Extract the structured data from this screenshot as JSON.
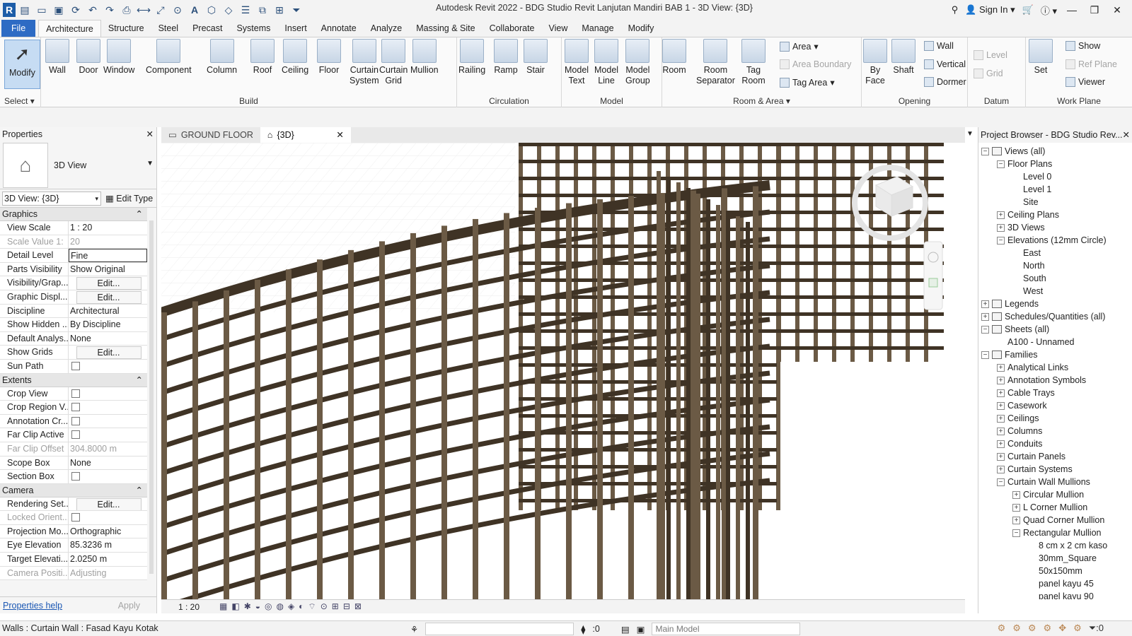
{
  "titlebar": {
    "title": "Autodesk Revit 2022 - BDG Studio Revit Lanjutan Mandiri BAB 1 - 3D View: {3D}",
    "sign_in": "Sign In",
    "logo": "R"
  },
  "tabs": [
    "File",
    "Architecture",
    "Structure",
    "Steel",
    "Precast",
    "Systems",
    "Insert",
    "Annotate",
    "Analyze",
    "Massing & Site",
    "Collaborate",
    "View",
    "Manage",
    "Modify"
  ],
  "ribbon": {
    "select": {
      "modify": "Modify",
      "label": "Select"
    },
    "build": {
      "label": "Build",
      "buttons": [
        "Wall",
        "Door",
        "Window",
        "Component",
        "Column",
        "Roof",
        "Ceiling",
        "Floor",
        "Curtain\nSystem",
        "Curtain\nGrid",
        "Mullion"
      ]
    },
    "circulation": {
      "label": "Circulation",
      "buttons": [
        "Railing",
        "Ramp",
        "Stair"
      ]
    },
    "model": {
      "label": "Model",
      "buttons": [
        "Model\nText",
        "Model\nLine",
        "Model\nGroup"
      ]
    },
    "room_area": {
      "label": "Room & Area",
      "buttons": [
        "Room",
        "Room\nSeparator",
        "Tag\nRoom"
      ],
      "small": [
        "Area",
        "Area Boundary",
        "Tag Area"
      ]
    },
    "opening": {
      "label": "Opening",
      "buttons": [
        "By\nFace",
        "Shaft"
      ],
      "small": [
        "Wall",
        "Vertical",
        "Dormer"
      ]
    },
    "datum": {
      "label": "Datum",
      "small": [
        "Level",
        "Grid"
      ]
    },
    "work_plane": {
      "label": "Work Plane",
      "buttons": [
        "Set"
      ],
      "small": [
        "Show",
        "Ref Plane",
        "Viewer"
      ]
    }
  },
  "properties": {
    "title": "Properties",
    "type_name": "3D View",
    "view_selector": "3D View: {3D}",
    "edit_type": "Edit Type",
    "sections": [
      {
        "name": "Graphics",
        "rows": [
          {
            "k": "View Scale",
            "v": "1 : 20"
          },
          {
            "k": "Scale Value    1:",
            "v": "20",
            "dim": true
          },
          {
            "k": "Detail Level",
            "v": "Fine",
            "boxed": true
          },
          {
            "k": "Parts Visibility",
            "v": "Show Original"
          },
          {
            "k": "Visibility/Grap...",
            "v": "Edit...",
            "button": true
          },
          {
            "k": "Graphic Displ...",
            "v": "Edit...",
            "button": true
          },
          {
            "k": "Discipline",
            "v": "Architectural"
          },
          {
            "k": "Show Hidden ...",
            "v": "By Discipline"
          },
          {
            "k": "Default Analys...",
            "v": "None"
          },
          {
            "k": "Show Grids",
            "v": "Edit...",
            "button": true
          },
          {
            "k": "Sun Path",
            "v": "",
            "check": true
          }
        ]
      },
      {
        "name": "Extents",
        "rows": [
          {
            "k": "Crop View",
            "v": "",
            "check": true
          },
          {
            "k": "Crop Region V...",
            "v": "",
            "check": true
          },
          {
            "k": "Annotation Cr...",
            "v": "",
            "check": true
          },
          {
            "k": "Far Clip Active",
            "v": "",
            "check": true
          },
          {
            "k": "Far Clip Offset",
            "v": "304.8000 m",
            "dim": true
          },
          {
            "k": "Scope Box",
            "v": "None"
          },
          {
            "k": "Section Box",
            "v": "",
            "check": true
          }
        ]
      },
      {
        "name": "Camera",
        "rows": [
          {
            "k": "Rendering Set...",
            "v": "Edit...",
            "button": true
          },
          {
            "k": "Locked Orient...",
            "v": "",
            "check": true,
            "dim": true
          },
          {
            "k": "Projection Mo...",
            "v": "Orthographic"
          },
          {
            "k": "Eye Elevation",
            "v": "85.3236 m"
          },
          {
            "k": "Target Elevati...",
            "v": "2.0250 m"
          },
          {
            "k": "Camera Positi...",
            "v": "Adjusting",
            "dim": true
          }
        ]
      }
    ],
    "help": "Properties help",
    "apply": "Apply"
  },
  "view_tabs": [
    {
      "label": "GROUND FLOOR"
    },
    {
      "label": "{3D}",
      "active": true
    }
  ],
  "view_status": {
    "scale": "1 : 20"
  },
  "browser": {
    "title": "Project Browser - BDG Studio Rev...",
    "nodes": [
      {
        "label": "Views (all)",
        "lvl": 0,
        "tg": "-",
        "icon": true
      },
      {
        "label": "Floor Plans",
        "lvl": 1,
        "tg": "-"
      },
      {
        "label": "Level 0",
        "lvl": 2
      },
      {
        "label": "Level 1",
        "lvl": 2
      },
      {
        "label": "Site",
        "lvl": 2
      },
      {
        "label": "Ceiling Plans",
        "lvl": 1,
        "tg": "+"
      },
      {
        "label": "3D Views",
        "lvl": 1,
        "tg": "+"
      },
      {
        "label": "Elevations (12mm Circle)",
        "lvl": 1,
        "tg": "-"
      },
      {
        "label": "East",
        "lvl": 2
      },
      {
        "label": "North",
        "lvl": 2
      },
      {
        "label": "South",
        "lvl": 2
      },
      {
        "label": "West",
        "lvl": 2
      },
      {
        "label": "Legends",
        "lvl": 0,
        "tg": "+",
        "icon": true
      },
      {
        "label": "Schedules/Quantities (all)",
        "lvl": 0,
        "tg": "+",
        "icon": true
      },
      {
        "label": "Sheets (all)",
        "lvl": 0,
        "tg": "-",
        "icon": true
      },
      {
        "label": "A100 - Unnamed",
        "lvl": 1
      },
      {
        "label": "Families",
        "lvl": 0,
        "tg": "-",
        "icon": true
      },
      {
        "label": "Analytical Links",
        "lvl": 1,
        "tg": "+"
      },
      {
        "label": "Annotation Symbols",
        "lvl": 1,
        "tg": "+"
      },
      {
        "label": "Cable Trays",
        "lvl": 1,
        "tg": "+"
      },
      {
        "label": "Casework",
        "lvl": 1,
        "tg": "+"
      },
      {
        "label": "Ceilings",
        "lvl": 1,
        "tg": "+"
      },
      {
        "label": "Columns",
        "lvl": 1,
        "tg": "+"
      },
      {
        "label": "Conduits",
        "lvl": 1,
        "tg": "+"
      },
      {
        "label": "Curtain Panels",
        "lvl": 1,
        "tg": "+"
      },
      {
        "label": "Curtain Systems",
        "lvl": 1,
        "tg": "+"
      },
      {
        "label": "Curtain Wall Mullions",
        "lvl": 1,
        "tg": "-"
      },
      {
        "label": "Circular Mullion",
        "lvl": 2,
        "tg": "+"
      },
      {
        "label": "L Corner Mullion",
        "lvl": 2,
        "tg": "+"
      },
      {
        "label": "Quad Corner Mullion",
        "lvl": 2,
        "tg": "+"
      },
      {
        "label": "Rectangular Mullion",
        "lvl": 2,
        "tg": "-"
      },
      {
        "label": "8 cm x 2 cm kaso",
        "lvl": 3
      },
      {
        "label": "30mm_Square",
        "lvl": 3
      },
      {
        "label": "50x150mm",
        "lvl": 3
      },
      {
        "label": "panel kayu 45",
        "lvl": 3
      },
      {
        "label": "panel kayu 90",
        "lvl": 3
      }
    ]
  },
  "statusbar": {
    "left": "Walls : Curtain Wall : Fasad Kayu Kotak",
    "count": ":0",
    "model": "Main Model",
    "filter_count": ":0"
  },
  "colors": {
    "wood": "#6b5a45",
    "wood_dark": "#3f3325",
    "file_tab": "#2d6bc4"
  }
}
